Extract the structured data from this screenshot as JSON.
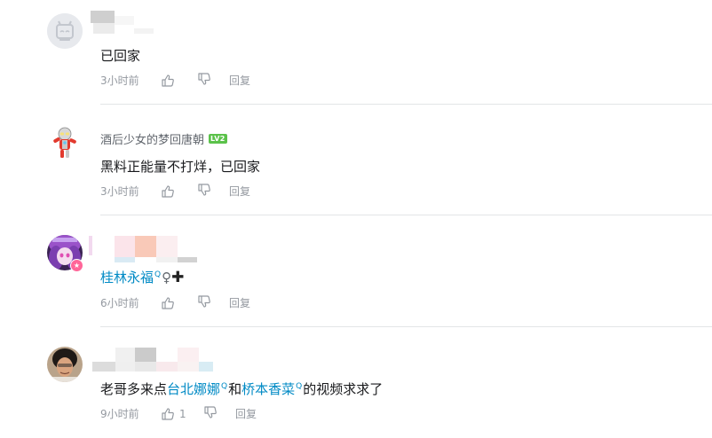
{
  "comments": [
    {
      "username": "",
      "level_badge": "",
      "text": "已回家",
      "time": "3小时前",
      "like_count": "",
      "reply_label": "回复"
    },
    {
      "username": "酒后少女的梦回唐朝",
      "level_badge": "LV2",
      "text": "黑料正能量不打烊，已回家",
      "time": "3小时前",
      "like_count": "",
      "reply_label": "回复"
    },
    {
      "username": "",
      "level_badge": "",
      "text_link": "桂林永福",
      "text_symbols": "♀",
      "text_plus": "✚",
      "time": "6小时前",
      "like_count": "",
      "reply_label": "回复"
    },
    {
      "username": "",
      "level_badge": "",
      "text_prefix": "老哥多来点",
      "link1": "台北娜娜",
      "text_mid": "和",
      "link2": "桥本香菜",
      "text_suffix": "的视频求求了",
      "time": "9小时前",
      "like_count": "1",
      "reply_label": "回复"
    }
  ],
  "colors": {
    "link": "#008ac5",
    "meta_text": "#9499a0",
    "level_badge": "#5bc24a",
    "divider": "#e3e5e7"
  },
  "icons": {
    "like": "thumbs-up-icon",
    "dislike": "thumbs-down-icon",
    "search_tag": "search-tag-icon"
  }
}
